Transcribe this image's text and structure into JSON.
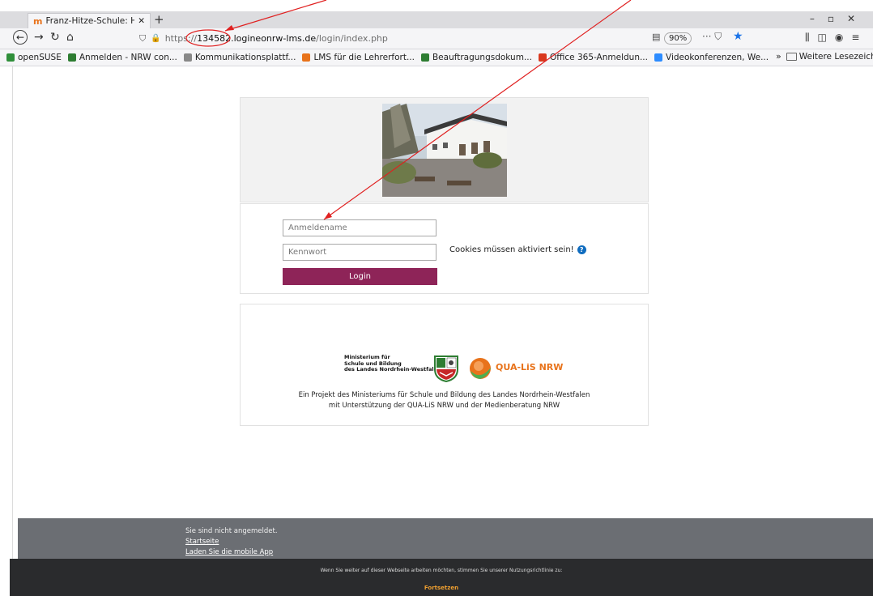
{
  "browser": {
    "tab_title": "Franz-Hitze-Schule: Hier",
    "new_tab": "+",
    "url_scheme": "https://",
    "url_host": "134582.logineonrw-lms.de",
    "url_path": "/login/index.php",
    "zoom": "90%",
    "bookmarks": [
      {
        "label": "openSUSE",
        "color": "#2f8f3a"
      },
      {
        "label": "Anmelden - NRW con...",
        "color": "#2e7d32"
      },
      {
        "label": "Kommunikationsplattf...",
        "color": "#888888"
      },
      {
        "label": "LMS für die Lehrerfort...",
        "color": "#e8731b"
      },
      {
        "label": "Beauftragungsdokum...",
        "color": "#2e7d32"
      },
      {
        "label": "Office 365-Anmeldun...",
        "color": "#d9381e"
      },
      {
        "label": "Videokonferenzen, We...",
        "color": "#2d8cff"
      }
    ],
    "bookmarks_more": "Weitere Lesezeichen"
  },
  "login": {
    "username_placeholder": "Anmeldename",
    "password_placeholder": "Kennwort",
    "login_button": "Login",
    "cookies_notice": "Cookies müssen aktiviert sein!",
    "help_icon": "?"
  },
  "logos": {
    "ministry_lines": [
      "Ministerium für",
      "Schule und Bildung",
      "des Landes Nordrhein-Westfalen"
    ],
    "qua_lis": "QUA-LiS",
    "qua_nrw": "NRW",
    "project_line1": "Ein Projekt des Ministeriums für Schule und Bildung des Landes Nordrhein-Westfalen",
    "project_line2": "mit Unterstützung der QUA-LiS NRW und der Medienberatung NRW"
  },
  "footer": {
    "status": "Sie sind nicht angemeldet.",
    "home_link": "Startseite",
    "app_link": "Laden Sie die mobile App"
  },
  "consent": {
    "text": "Wenn Sie weiter auf dieser Webseite arbeiten möchten, stimmen Sie unserer Nutzungsrichtlinie zu:",
    "continue_button": "Fortsetzen"
  },
  "colors": {
    "login_button": "#8e2458",
    "annotation": "#e02020",
    "qua_orange": "#e8731b",
    "qua_green": "#4caf50"
  }
}
